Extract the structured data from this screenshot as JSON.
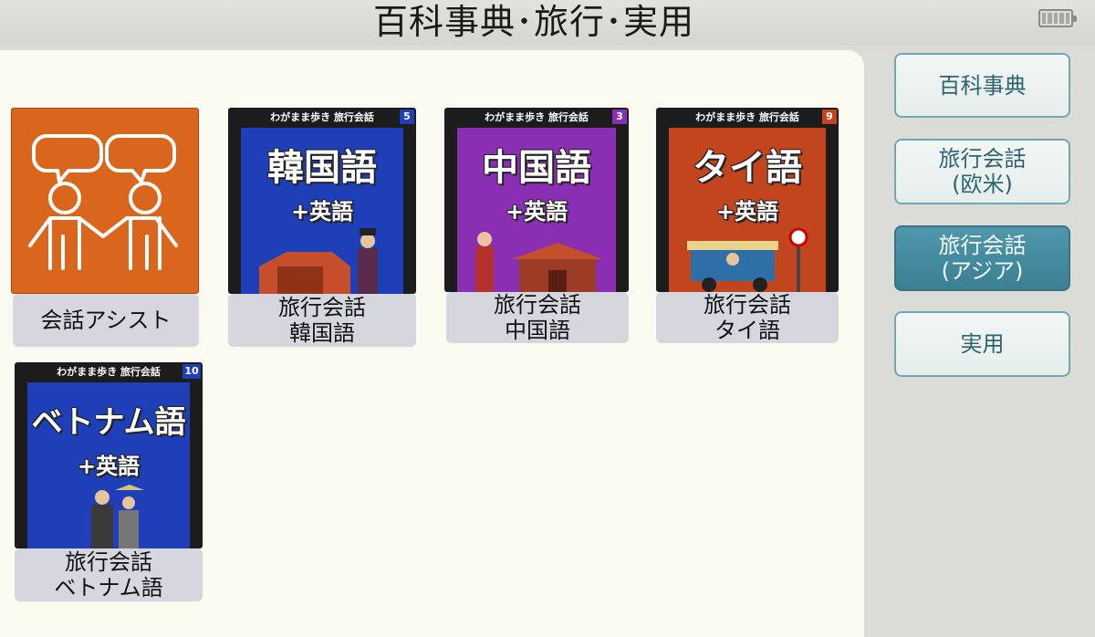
{
  "header": {
    "title": "百科事典･旅行･実用"
  },
  "tiles": [
    {
      "label_line1": "会話アシスト",
      "label_line2": ""
    },
    {
      "label_line1": "旅行会話",
      "label_line2": "韓国語",
      "series": "わがまま歩き 旅行会話",
      "number": "5",
      "cover_lang": "韓国語",
      "cover_plus": "+英語",
      "cover_color": "#1e3fb8"
    },
    {
      "label_line1": "旅行会話",
      "label_line2": "中国語",
      "series": "わがまま歩き 旅行会話",
      "number": "3",
      "cover_lang": "中国語",
      "cover_plus": "+英語",
      "cover_color": "#8a2fb3"
    },
    {
      "label_line1": "旅行会話",
      "label_line2": "タイ語",
      "series": "わがまま歩き 旅行会話",
      "number": "9",
      "cover_lang": "タイ語",
      "cover_plus": "+英語",
      "cover_color": "#c2451e"
    },
    {
      "label_line1": "旅行会話",
      "label_line2": "ベトナム語",
      "series": "わがまま歩き 旅行会話",
      "number": "10",
      "cover_lang": "ベトナム語",
      "cover_plus": "+英語",
      "cover_color": "#1e3fb8"
    }
  ],
  "sidebar": {
    "items": [
      {
        "line1": "百科事典",
        "line2": ""
      },
      {
        "line1": "旅行会話",
        "line2": "(欧米)"
      },
      {
        "line1": "旅行会話",
        "line2": "(アジア)"
      },
      {
        "line1": "実用",
        "line2": ""
      }
    ],
    "active_index": 2
  },
  "colors": {
    "assist_orange": "#d9661c",
    "accent_teal": "#4f97ab"
  }
}
